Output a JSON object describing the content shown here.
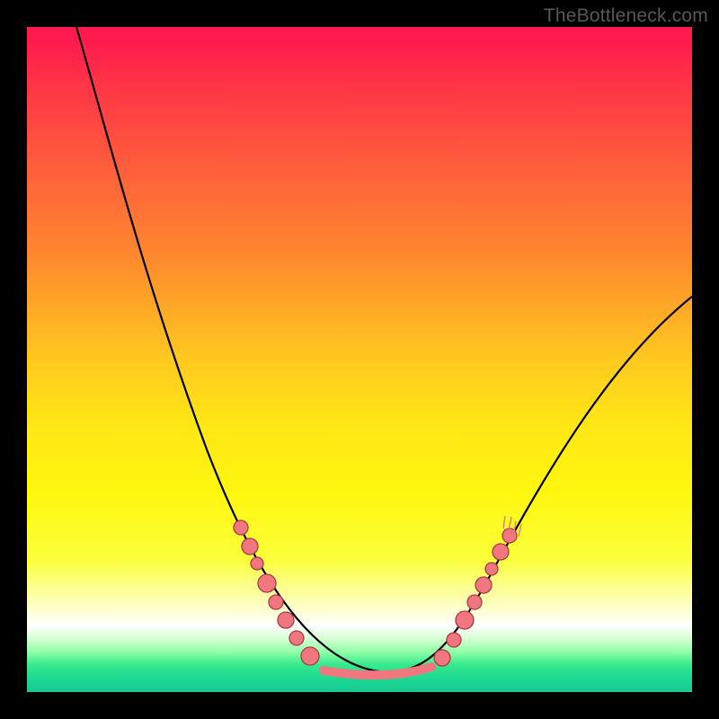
{
  "attribution": "TheBottleneck.com",
  "colors": {
    "frame": "#000000",
    "attribution_text": "#575757",
    "curve": "#000000",
    "marker_fill": "#f07780",
    "marker_stroke": "#a83c44",
    "gradient_top": "#ff1a4d",
    "gradient_bottom": "#19c893"
  },
  "chart_data": {
    "type": "line",
    "title": "",
    "xlabel": "",
    "ylabel": "",
    "xlim": [
      0,
      100
    ],
    "ylim": [
      0,
      100
    ],
    "grid": false,
    "series": [
      {
        "name": "bottleneck-curve",
        "x": [
          10,
          15,
          20,
          25,
          30,
          35,
          40,
          45,
          50,
          55,
          60,
          65,
          70,
          75,
          80,
          85,
          90,
          95,
          100
        ],
        "values": [
          100,
          90,
          78,
          65,
          51,
          39,
          28,
          17,
          9,
          4,
          3,
          5,
          11,
          19,
          27,
          35,
          43,
          51,
          58
        ]
      }
    ],
    "annotations": [
      {
        "type": "marker-cluster",
        "side": "left",
        "x_range": [
          33,
          45
        ],
        "y_range": [
          6,
          25
        ]
      },
      {
        "type": "marker-cluster",
        "side": "right",
        "x_range": [
          60,
          72
        ],
        "y_range": [
          6,
          25
        ]
      },
      {
        "type": "plateau-band",
        "x_range": [
          45,
          60
        ],
        "y": 3
      }
    ]
  }
}
